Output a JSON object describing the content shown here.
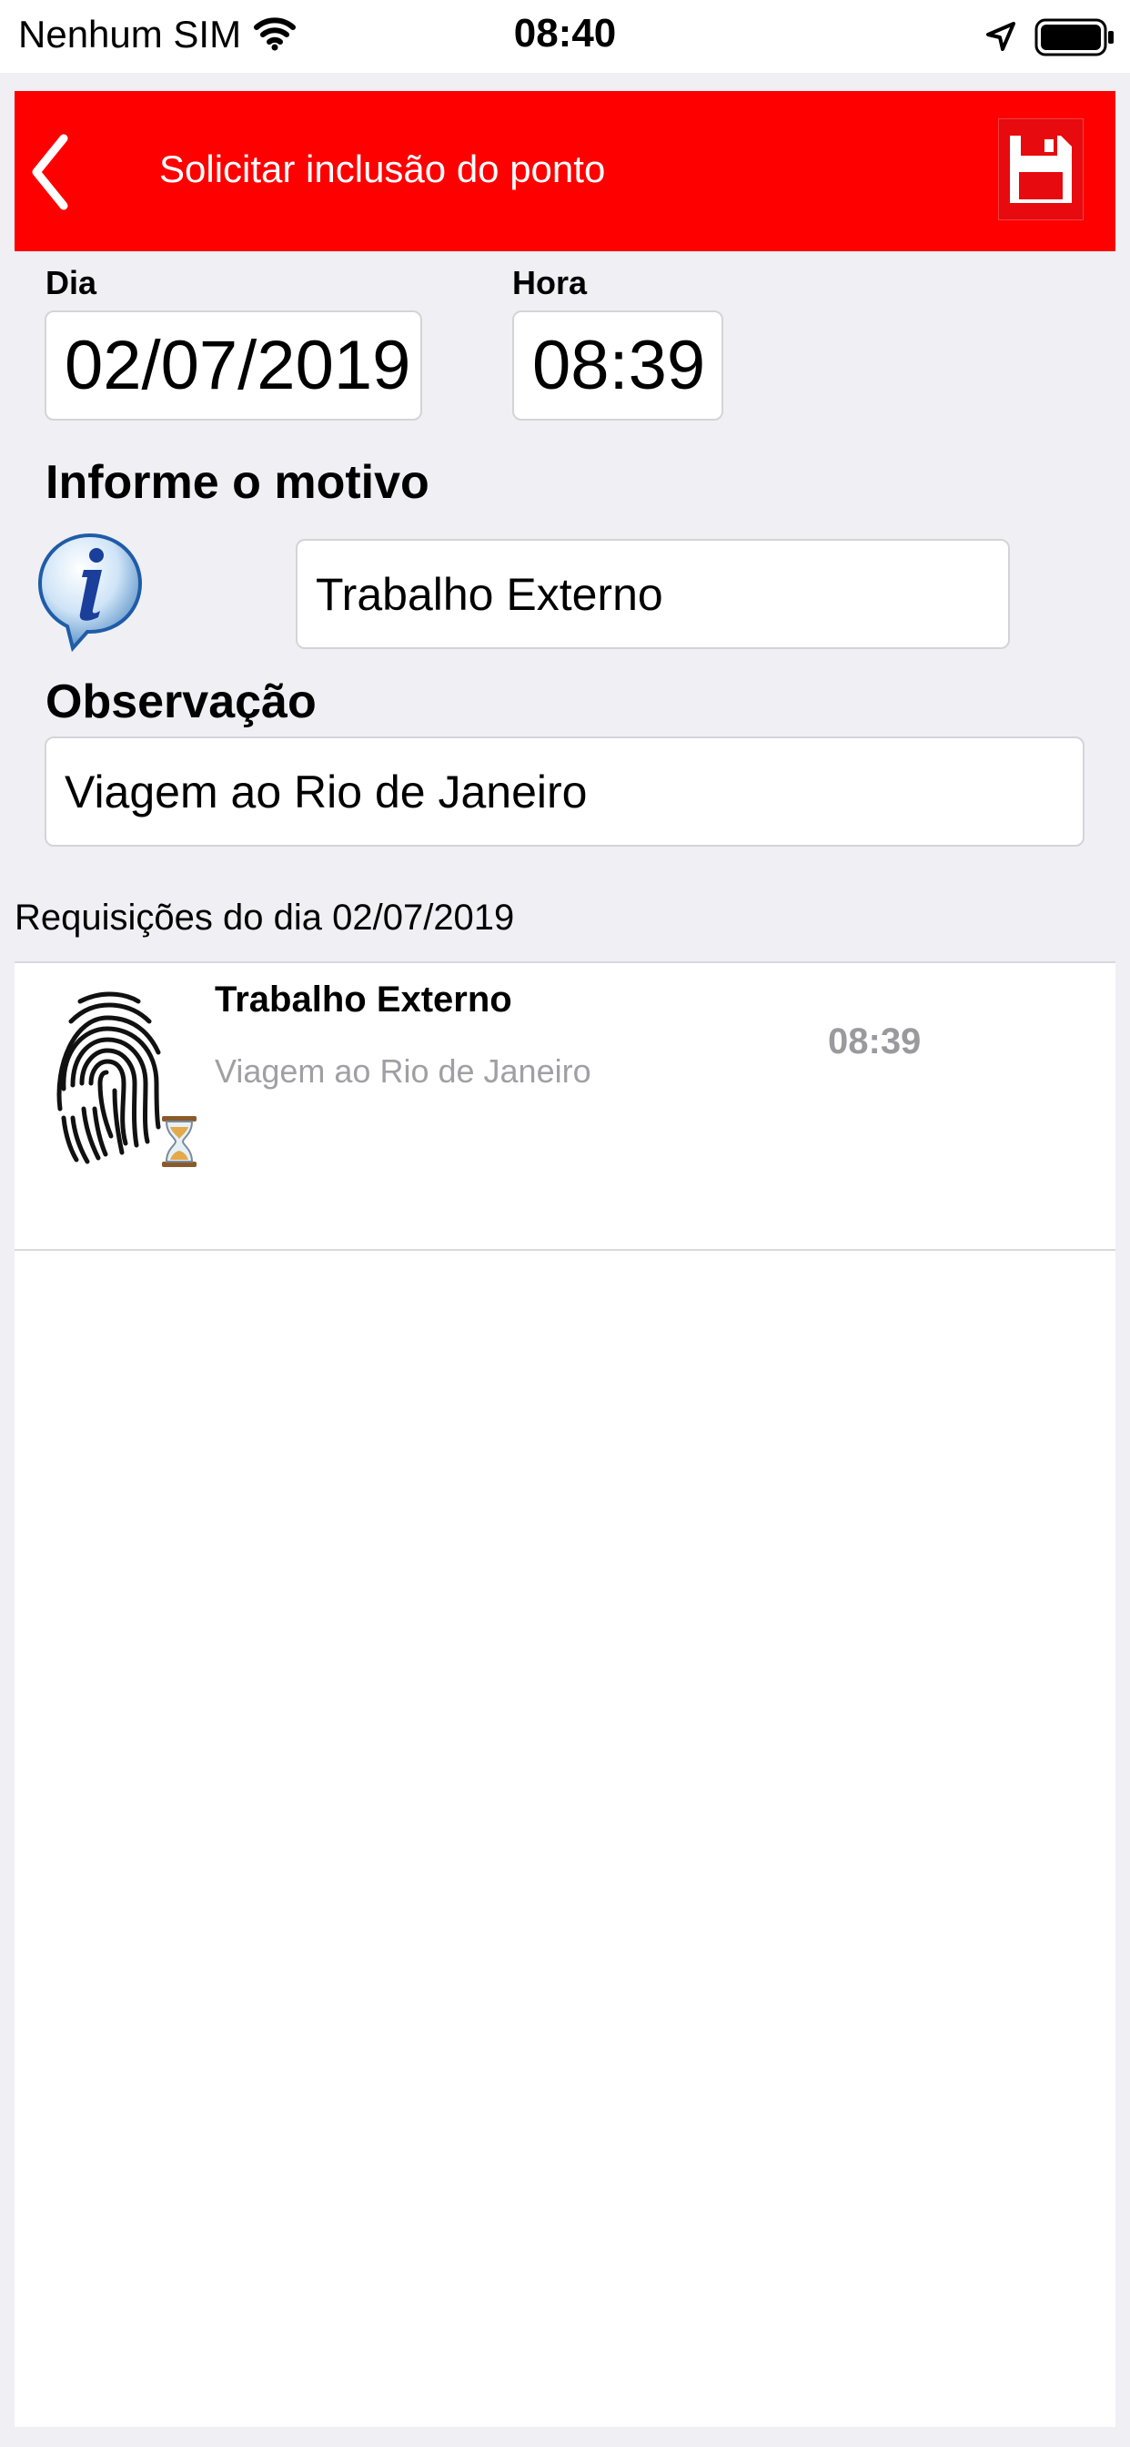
{
  "status_bar": {
    "carrier": "Nenhum SIM",
    "time": "08:40",
    "icons": [
      "wifi-icon",
      "location-arrow-icon",
      "battery-icon"
    ]
  },
  "nav_bar": {
    "title": "Solicitar inclusão do ponto",
    "background_color": "#ff0000",
    "back_icon": "chevron-left-icon",
    "save_icon": "floppy-disk-icon"
  },
  "form": {
    "dia_label": "Dia",
    "dia_value": "02/07/2019",
    "hora_label": "Hora",
    "hora_value": "08:39",
    "motivo_label": "Informe o motivo",
    "motivo_icon": "info-icon",
    "motivo_value": "Trabalho Externo",
    "observacao_label": "Observação",
    "observacao_value": "Viagem ao Rio de Janeiro"
  },
  "requests": {
    "header": "Requisições do dia 02/07/2019",
    "items": [
      {
        "title": "Trabalho Externo",
        "subtitle": "Viagem ao Rio de Janeiro",
        "time": "08:39",
        "icon": "fingerprint-icon",
        "status_icon": "hourglass-icon"
      }
    ]
  }
}
